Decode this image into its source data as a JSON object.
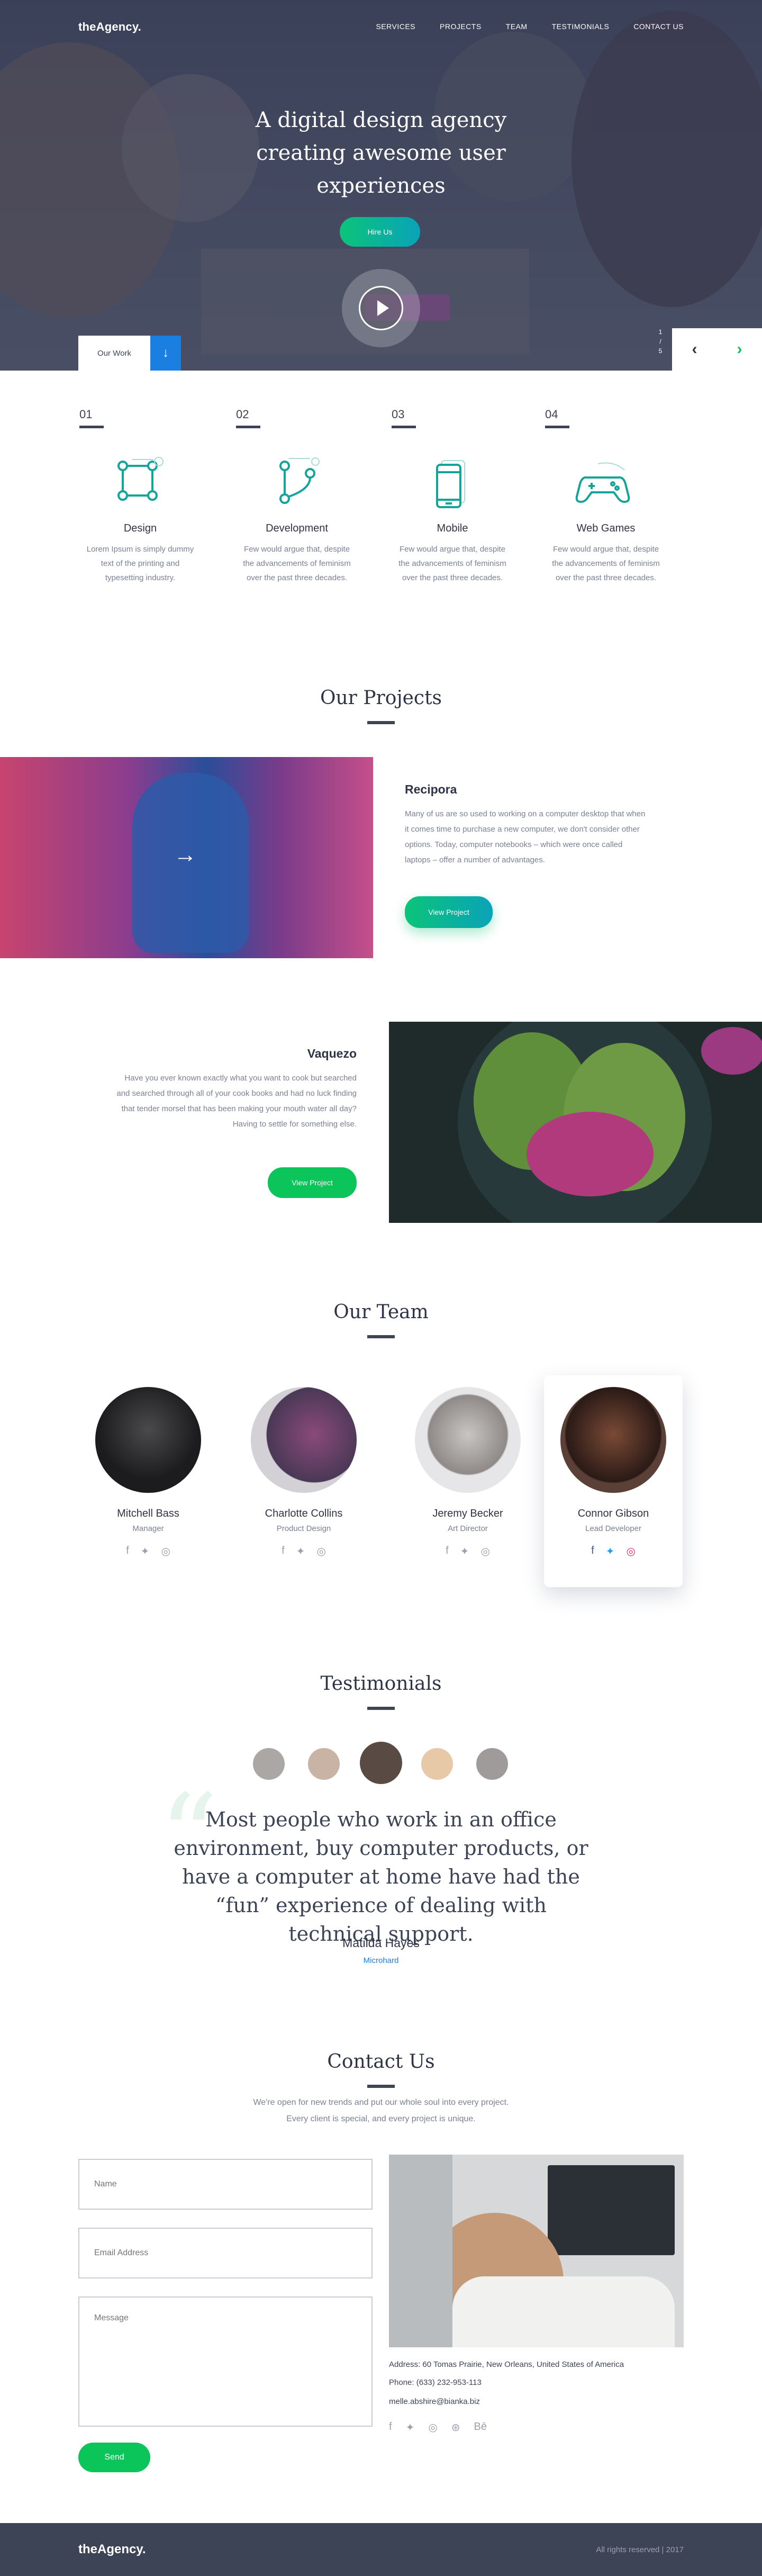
{
  "brand": {
    "logo": "theAgency."
  },
  "nav": [
    "SERVICES",
    "PROJECTS",
    "TEAM",
    "TESTIMONIALS",
    "CONTACT US"
  ],
  "hero": {
    "title": "A digital design agency creating awesome user experiences",
    "hire_label": "Hire Us",
    "our_work_label": "Our Work",
    "counter_current": "1",
    "counter_total": "5"
  },
  "services": [
    {
      "num": "01",
      "title": "Design",
      "text": "Lorem Ipsum is simply dummy text of the printing and typesetting industry.",
      "icon": "vector-square-icon"
    },
    {
      "num": "02",
      "title": "Development",
      "text": "Few would argue that, despite the advancements of feminism over the past three decades.",
      "icon": "git-branch-icon"
    },
    {
      "num": "03",
      "title": "Mobile",
      "text": "Few would argue that, despite the advancements of feminism over the past three decades.",
      "icon": "mobile-phone-icon"
    },
    {
      "num": "04",
      "title": "Web Games",
      "text": "Few would argue that, despite the advancements of feminism over the past three decades.",
      "icon": "gamepad-icon"
    }
  ],
  "projects": {
    "title": "Our Projects",
    "items": [
      {
        "title": "Recipora",
        "text": "Many of us are so used to working on a computer desktop that when it comes time to purchase a new computer, we don't consider other options. Today, computer notebooks – which were once called laptops – offer a number of advantages.",
        "button": "View Project"
      },
      {
        "title": "Vaquezo",
        "text": "Have you ever known exactly what you want to cook but searched and searched through all of your cook books and had no luck finding that tender morsel that has been making your mouth water all day? Having to settle for something else.",
        "button": "View Project"
      }
    ]
  },
  "team": {
    "title": "Our Team",
    "members": [
      {
        "name": "Mitchell Bass",
        "role": "Manager"
      },
      {
        "name": "Charlotte Collins",
        "role": "Product Design"
      },
      {
        "name": "Jeremy Becker",
        "role": "Art Director"
      },
      {
        "name": "Connor Gibson",
        "role": "Lead Developer"
      }
    ],
    "social_icons": [
      "facebook-icon",
      "twitter-icon",
      "instagram-icon"
    ]
  },
  "testimonials": {
    "title": "Testimonials",
    "quote": "Most people who work in an office environment, buy computer products, or have a computer at home have had the “fun” experience of dealing with technical support.",
    "name": "Matilda Hayes",
    "role": "Microhard"
  },
  "contact": {
    "title": "Contact Us",
    "subtitle_line1": "We're open for new trends and put our whole soul into every project.",
    "subtitle_line2": "Every client is special, and every project is unique.",
    "name_placeholder": "Name",
    "email_placeholder": "Email Address",
    "message_placeholder": "Message",
    "send_label": "Send",
    "address_label": "Address:",
    "address": "60 Tomas Prairie, New Orleans, United States of America",
    "phone_label": "Phone:",
    "phone": "(633) 232-953-113",
    "email": "melle.abshire@bianka.biz",
    "behance": "Bē"
  },
  "footer": {
    "logo": "theAgency.",
    "copyright": "All rights reserved | 2017"
  },
  "colors": {
    "accent_green": "#0bc45a",
    "accent_blue": "#1a7fe0",
    "dark": "#3d4456",
    "teal_icon": "#14a49a"
  }
}
